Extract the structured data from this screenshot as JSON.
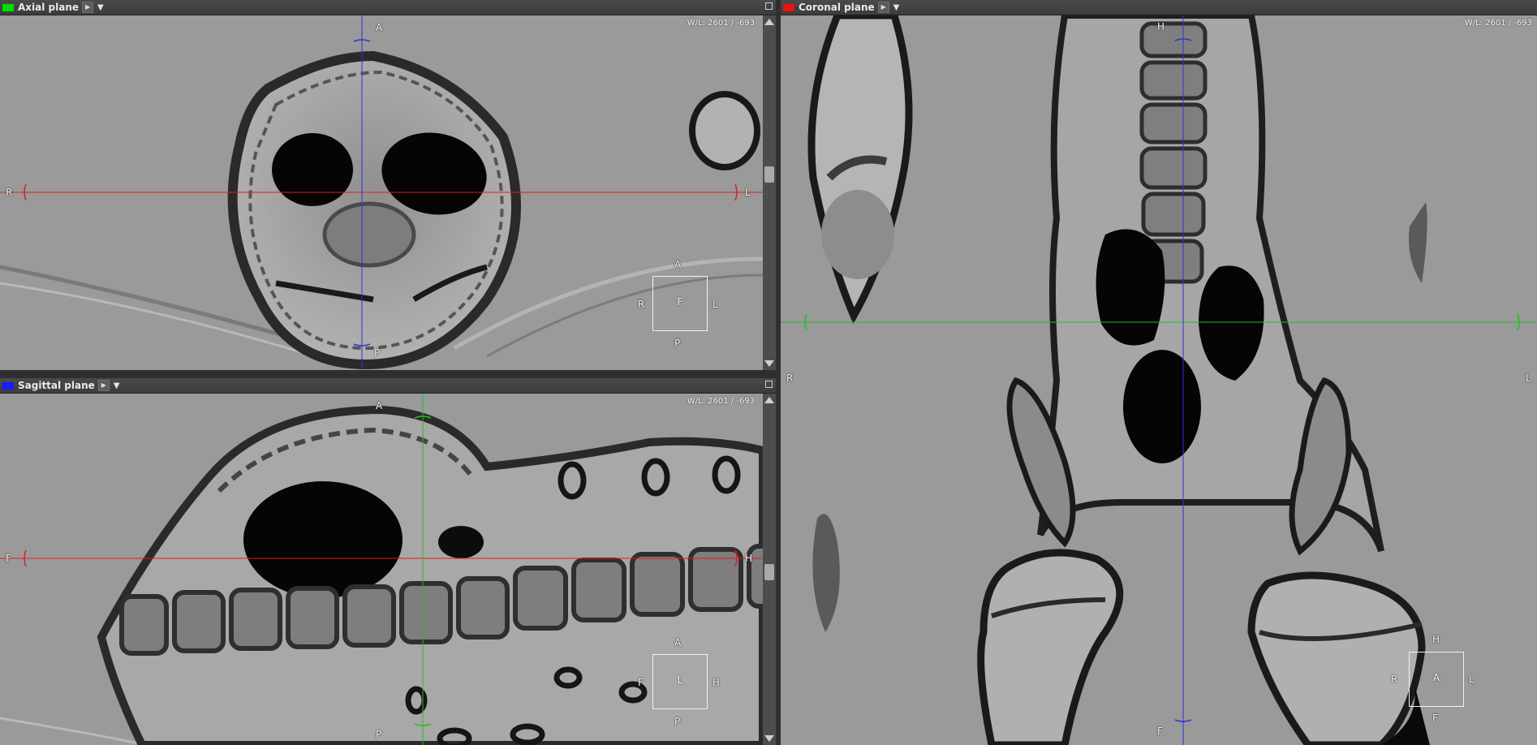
{
  "viewports": {
    "axial": {
      "title": "Axial plane",
      "swatch_color": "#00e000",
      "wl": "W/L: 2601 / -693",
      "labels": {
        "top": "A",
        "bottom": "P",
        "left": "R",
        "right": "L"
      },
      "cube": {
        "top": "A",
        "bottom": "P",
        "left": "R",
        "right": "L",
        "face": "F"
      },
      "h_line_color": "#e02020",
      "v_line_color": "#3030e0"
    },
    "sagittal": {
      "title": "Sagittal plane",
      "swatch_color": "#1a1aff",
      "wl": "W/L: 2601 / -693",
      "labels": {
        "top": "A",
        "bottom": "P",
        "left": "F",
        "right": "H"
      },
      "cube": {
        "top": "A",
        "bottom": "P",
        "left": "F",
        "right": "H",
        "face": "L"
      },
      "h_line_color": "#e02020",
      "v_line_color": "#20c020"
    },
    "coronal": {
      "title": "Coronal plane",
      "swatch_color": "#ee1111",
      "wl": "W/L: 2601 / -693",
      "labels": {
        "top": "H",
        "bottom": "F",
        "left": "R",
        "right": "L"
      },
      "cube": {
        "top": "H",
        "bottom": "F",
        "left": "R",
        "right": "L",
        "face": "A"
      },
      "h_line_color": "#20c020",
      "v_line_color": "#3030e0"
    }
  },
  "icons": {
    "menu_arrow": "play-arrow-icon",
    "dropdown": "chevron-down-icon",
    "maximize": "maximize-icon"
  }
}
